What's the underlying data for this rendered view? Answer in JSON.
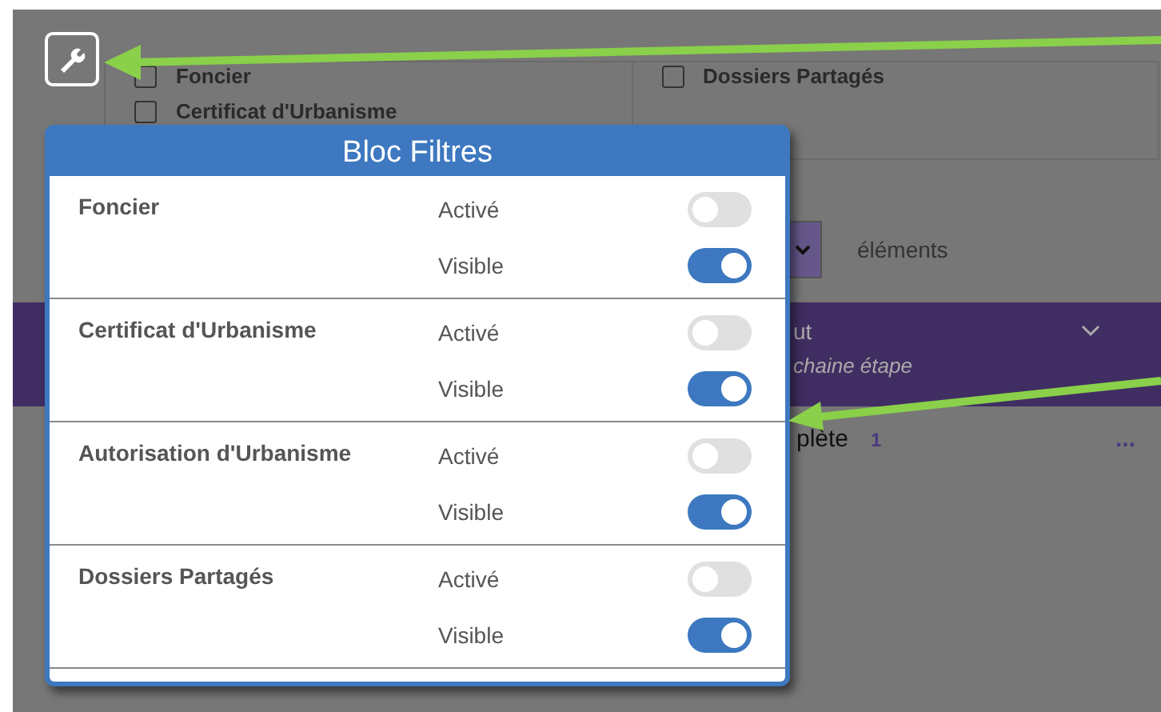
{
  "background": {
    "filters": [
      {
        "label": "Foncier",
        "checked": false
      },
      {
        "label": "Certificat d'Urbanisme",
        "checked": false
      },
      {
        "label": "Dossiers Partagés",
        "checked": false
      }
    ],
    "page_size_suffix": "éléments",
    "band": {
      "heading": "ut",
      "subtitle": "chaine étape"
    },
    "row": {
      "text": "plète",
      "count": "1",
      "more": "..."
    }
  },
  "modal": {
    "title": "Bloc Filtres",
    "sections": [
      {
        "name": "Foncier",
        "toggles": [
          {
            "label": "Activé",
            "on": false
          },
          {
            "label": "Visible",
            "on": true
          }
        ]
      },
      {
        "name": "Certificat d'Urbanisme",
        "toggles": [
          {
            "label": "Activé",
            "on": false
          },
          {
            "label": "Visible",
            "on": true
          }
        ]
      },
      {
        "name": "Autorisation d'Urbanisme",
        "toggles": [
          {
            "label": "Activé",
            "on": false
          },
          {
            "label": "Visible",
            "on": true
          }
        ]
      },
      {
        "name": "Dossiers Partagés",
        "toggles": [
          {
            "label": "Activé",
            "on": false
          },
          {
            "label": "Visible",
            "on": true
          }
        ]
      }
    ]
  }
}
